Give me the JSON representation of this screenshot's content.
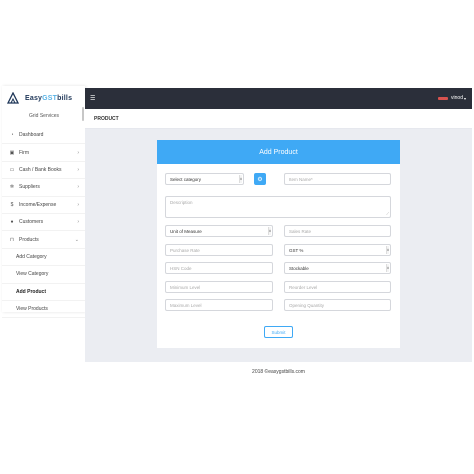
{
  "brand": {
    "name_part1": "Easy",
    "name_part2": "GST",
    "name_part3": "bills",
    "subtitle": "Grid Services"
  },
  "topbar": {
    "user": "vinod"
  },
  "page": {
    "title": "PRODUCT"
  },
  "sidebar": {
    "items": [
      {
        "label": "Dashboard",
        "icon": "speedometer-icon"
      },
      {
        "label": "Firm",
        "icon": "briefcase-icon",
        "caret": "›"
      },
      {
        "label": "Cash / Bank Books",
        "icon": "money-icon",
        "caret": "›"
      },
      {
        "label": "Suppliers",
        "icon": "gear-icon",
        "caret": "›"
      },
      {
        "label": "Income/Expense",
        "icon": "dollar-icon",
        "caret": "›"
      },
      {
        "label": "Customers",
        "icon": "user-icon",
        "caret": "›"
      },
      {
        "label": "Products",
        "icon": "cart-icon",
        "caret": "⌄"
      }
    ],
    "sub_items": [
      {
        "label": "Add Category"
      },
      {
        "label": "View Category"
      },
      {
        "label": "Add Product"
      },
      {
        "label": "View Products"
      }
    ]
  },
  "form": {
    "header": "Add Product",
    "category_select": "Select category",
    "item_name_placeholder": "Item Name*",
    "description_placeholder": "Description",
    "unit_select": "Unit of Measure",
    "sales_rate_placeholder": "Sales Rate",
    "purchase_rate_placeholder": "Purchase Rate",
    "gst_select": "GST %",
    "hsn_placeholder": "HSN Code",
    "stock_select": "Stockable",
    "min_level_placeholder": "Minimum Level",
    "reorder_level_placeholder": "Reorder Level",
    "max_level_placeholder": "Maximum Level",
    "opening_qty_placeholder": "Opening Quantity",
    "submit_label": "Submit"
  },
  "footer": {
    "text": "2018 ©easygstbills.com"
  },
  "colors": {
    "accent": "#3fa9f5",
    "topbar": "#2b2f3a",
    "content_bg": "#ebedf2"
  }
}
